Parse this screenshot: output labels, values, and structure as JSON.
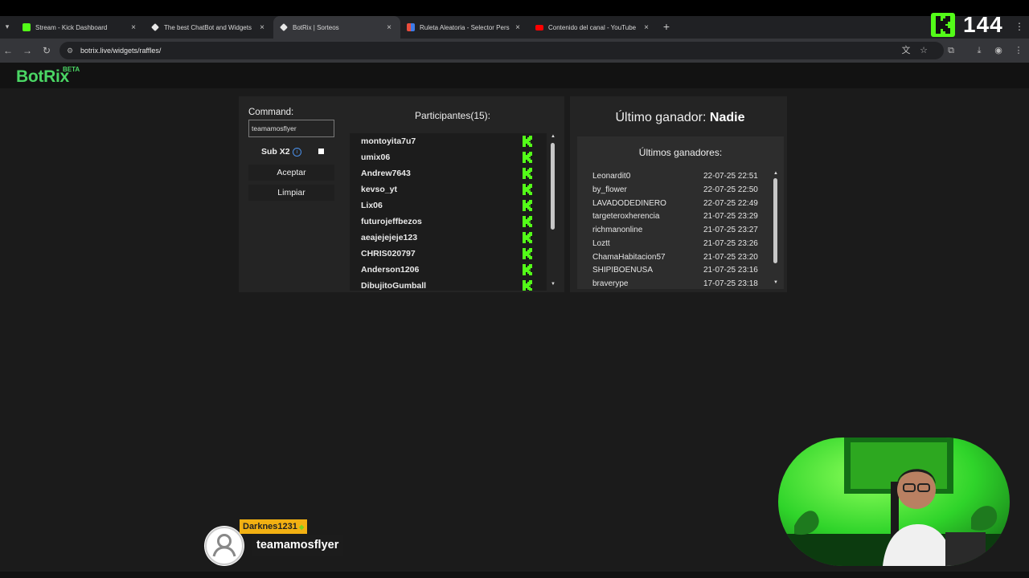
{
  "browser": {
    "tabs": [
      {
        "title": "Stream - Kick Dashboard",
        "favicon_color": "#53fc18",
        "active": false
      },
      {
        "title": "The best ChatBot and Widgets",
        "favicon_color": "#e8e8e8",
        "active": false
      },
      {
        "title": "BotRix | Sorteos",
        "favicon_color": "#e8e8e8",
        "active": true
      },
      {
        "title": "Ruleta Aleatoria - Selector Pers",
        "favicon_color": "#e84c3d",
        "active": false
      },
      {
        "title": "Contenido del canal - YouTube",
        "favicon_color": "#ff0000",
        "active": false
      }
    ],
    "url": "botrix.live/widgets/raffles/",
    "kick_counter": "144"
  },
  "site": {
    "logo": "BotRix",
    "beta": "BETA",
    "brand_color": "#4ad664"
  },
  "raffle": {
    "command_label": "Command:",
    "command_value": "teamamosflyer",
    "subx2_label": "Sub X2",
    "subx2_checked": false,
    "accept_label": "Aceptar",
    "clear_label": "Limpiar"
  },
  "participants": {
    "title": "Participantes(15):",
    "list": [
      "montoyita7u7",
      "umix06",
      "Andrew7643",
      "kevso_yt",
      "Lix06",
      "futurojeffbezos",
      "aeajejejeje123",
      "CHRIS020797",
      "Anderson1206",
      "DibujitoGumball"
    ]
  },
  "winner": {
    "label": "Último ganador:",
    "name": "Nadie"
  },
  "recent_winners": {
    "title": "Últimos ganadores:",
    "list": [
      {
        "name": "Leonardit0",
        "date": "22-07-25 22:51"
      },
      {
        "name": "by_flower",
        "date": "22-07-25 22:50"
      },
      {
        "name": "LAVADODEDINERO",
        "date": "22-07-25 22:49"
      },
      {
        "name": "targeteroxherencia",
        "date": "21-07-25 23:29"
      },
      {
        "name": "richmanonline",
        "date": "21-07-25 23:27"
      },
      {
        "name": "Loztt",
        "date": "21-07-25 23:26"
      },
      {
        "name": "ChamaHabitacion57",
        "date": "21-07-25 23:20"
      },
      {
        "name": "SHIPIBOENUSA",
        "date": "21-07-25 23:16"
      },
      {
        "name": "braverype",
        "date": "17-07-25 23:18"
      }
    ]
  },
  "overlay": {
    "donor": "Darknes1231",
    "username": "teamamosflyer"
  }
}
